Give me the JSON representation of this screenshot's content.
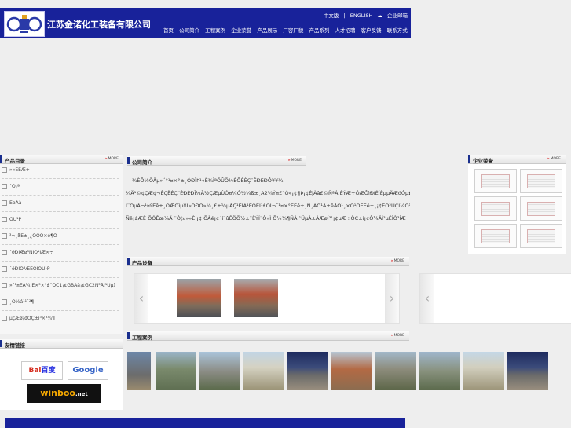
{
  "header": {
    "company_name": "江苏金诺化工装备有限公司",
    "lang_links": [
      "中文版",
      "ENGLISH",
      "企业邮箱"
    ],
    "nav": [
      "首页",
      "公司简介",
      "工程案例",
      "企业荣誉",
      "产品展示",
      "厂容厂貌",
      "产品系列",
      "人才招聘",
      "客户反馈",
      "联系方式"
    ],
    "brand_color": "#18229a"
  },
  "more_label": "MORE",
  "products": {
    "title": "产品目录",
    "items": [
      "»«ÊÈÆ÷",
      "´Ó¡ª",
      "ÉþÀà",
      "ÔÙ¹P",
      "³¬¸ßÈ±¸¿ÕÕÖ×é¶Ô",
      "´óÐÍÆø³ÑÎÓ¹ÎÆ×÷",
      "´óÐÍÕ³ÆÈÖÎÓÙ¹P",
      "»¯¹¤ÉÂ¼ÍÉ×³×°£¨ÓC1¡¢GBÂä¡¢GC2Ñ³Å¦¹Ùµ)",
      "¸Ö½á¹¹´²¶",
      "µçÆø¡¢ÒÇ±í³×³¾¶"
    ]
  },
  "about": {
    "title": "公司简介",
    "lines": [
      "¾­ÈÕ½­ÕÄµ»´°¹¤×°±¸ÓÐÏÞ¹«Ë¾ÎªÕÛÕ½ÈÕÈÈÇ¨ÊÐÈÐÔ¥¥¾",
      "¼Ä¹©¢ÇÆ¢¬ÊÇËÉÇ¨ÉÐÈÐÎ¼Ã½ÇÆµÙÓ¤¼Ó½¼ß±¸A2¼Ý¤£¨Ó«¡¢¶Þ¡¢ÉjÀâ£©ÑºÁ¦ÈÝÆ÷ÖÆÔìÐíÉÍÊµµÄÆóÓµ£¬Í¬Ê±Ó³ÉÇÈÕ±±µÑÇø³æÃ¥¥",
      "Í¨ÓµÄ¬¹¤ºÉê±¸ÖÆÔìµ¥Î»ÓÐÒ»¼¸£±¼µÄÇ¹ÊÎÂ¹ÈÕÊÌ¹£ÓÌ¬¯¹¤×°ÊÉê±¸Ñ¸ÀÓ¹Ä±êÅÓ¹¸×Ô¹ÓÉÊé±¸¡¢ÊÓ²ÚÇÍ¼Ó¹ÈÉìÍÎ¼ººÕ¤%",
      "Ñë¡£ÆÈ·ÕÓÊæ¼Ä·¨Ò¦¤»»ÈÍ¡¢·ÕÀé¡¢´í´ûÊÖÕ½±¨ÊÝÍ¨Ò»Ì·Õ½¾¶ÑÀ¦¹ÜµÀ±ÀÆøÍ³¹¡¢µÆ÷ÒÇ±í¡¢Ò¼ÄÌ³µÊÌÒ³ÍÆ÷½¼³³½³..........."
    ]
  },
  "honors": {
    "title": "企业荣誉"
  },
  "equipment": {
    "title": "产品设备",
    "prev": "‹",
    "next": "›"
  },
  "cases": {
    "title": "工程案例"
  },
  "links": {
    "title": "友情链接",
    "baidu_logo": "百度",
    "baidu_logo_latin": "Bai",
    "google_logo": "Google",
    "winboo_logo": "winboo",
    "winboo_suffix": ".net"
  }
}
